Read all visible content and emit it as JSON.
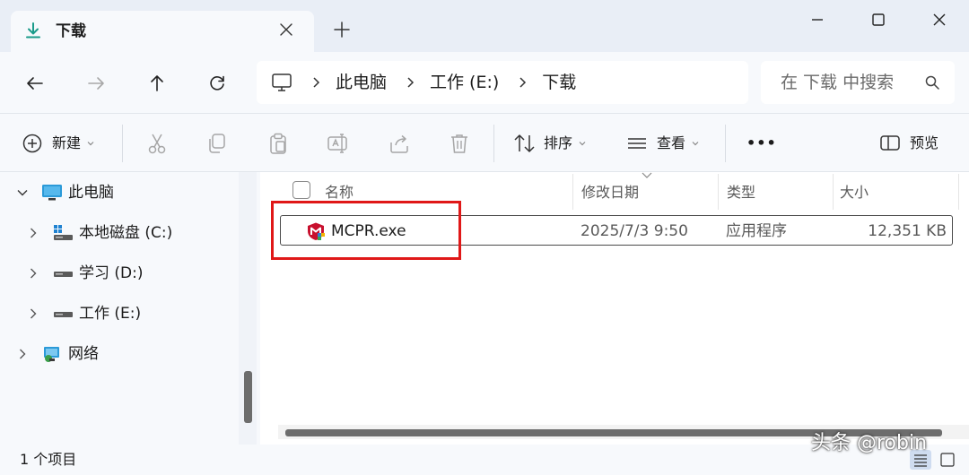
{
  "window": {
    "tab_title": "下载",
    "colors": {
      "accent": "#0067c0",
      "highlight_box": "#e01818",
      "chrome": "#e9eef6",
      "pane": "#f7f9fc"
    }
  },
  "address_bar": {
    "breadcrumbs": [
      "此电脑",
      "工作 (E:)",
      "下载"
    ]
  },
  "search": {
    "placeholder": "在 下载 中搜索"
  },
  "command_bar": {
    "new_label": "新建",
    "sort_label": "排序",
    "view_label": "查看",
    "more_label": "•••",
    "preview_label": "预览",
    "icons": [
      "cut-icon",
      "copy-icon",
      "paste-icon",
      "rename-icon",
      "share-icon",
      "delete-icon"
    ]
  },
  "nav_pane": {
    "items": [
      {
        "label": "此电脑",
        "icon": "computer-icon",
        "expanded": true
      },
      {
        "label": "本地磁盘 (C:)",
        "icon": "windows-drive-icon",
        "expanded": false
      },
      {
        "label": "学习 (D:)",
        "icon": "drive-icon",
        "expanded": false
      },
      {
        "label": "工作 (E:)",
        "icon": "drive-icon",
        "expanded": false
      },
      {
        "label": "网络",
        "icon": "network-icon",
        "expanded": false
      }
    ]
  },
  "file_list": {
    "columns": [
      "名称",
      "修改日期",
      "类型",
      "大小"
    ],
    "rows": [
      {
        "name": "MCPR.exe",
        "modified": "2025/7/3 9:50",
        "type": "应用程序",
        "size": "12,351 KB",
        "icon": "mcafee-app-icon",
        "selected": true
      }
    ]
  },
  "status_bar": {
    "item_count": "1 个项目"
  },
  "watermark": "头条 @robin"
}
